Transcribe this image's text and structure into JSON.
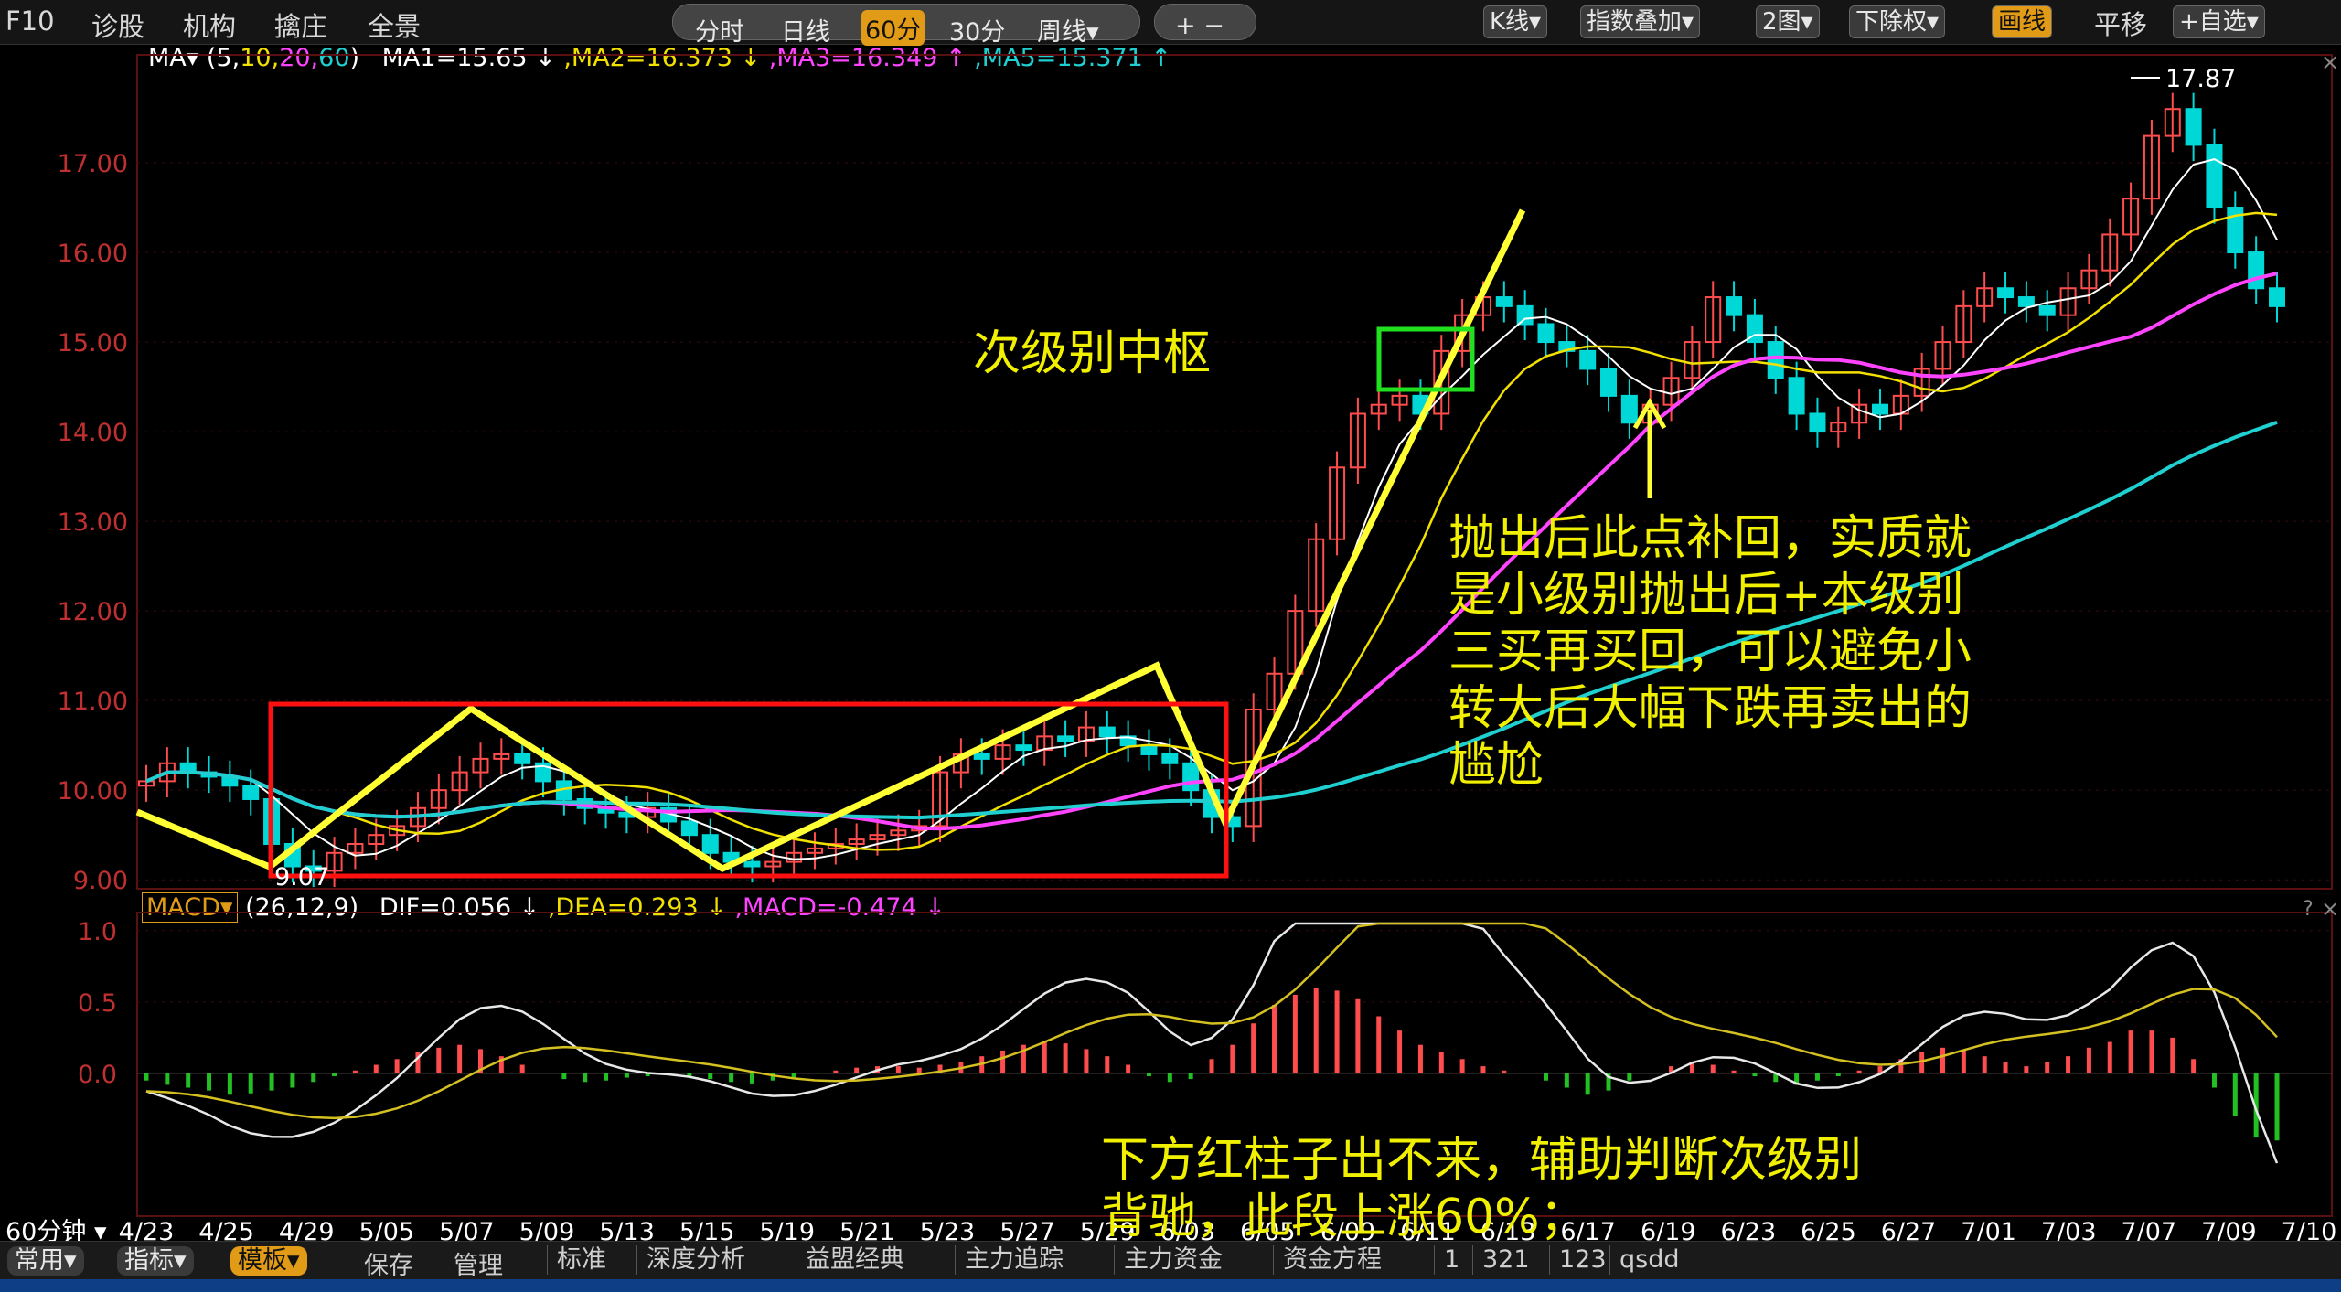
{
  "toolbar": {
    "left_items": [
      "F10",
      "诊股",
      "机构",
      "擒庄",
      "全景"
    ],
    "period_tabs": [
      "分时",
      "日线",
      "60分",
      "30分",
      "周线▾"
    ],
    "active_period": "60分",
    "zoom_controls": "+ −",
    "right_buttons": [
      "K线▾",
      "指数叠加▾",
      "2图▾",
      "下除权▾",
      "画线",
      "平移",
      "+自选▾"
    ],
    "active_right": "画线"
  },
  "ma_line": {
    "label": "MA▾",
    "params_open": "(",
    "p5": "5,",
    "p10": "10,",
    "p20": "20,",
    "p60": "60",
    "params_close": ")",
    "ma1": "MA1=15.65 ↓",
    "ma2": ",MA2=16.373 ↓",
    "ma3": ",MA3=16.349 ↑",
    "ma5": ",MA5=15.371 ↑"
  },
  "macd_line": {
    "label": "MACD▾",
    "params": "(26,12,9)",
    "dif": "DIF=0.056 ↓",
    "dea": ",DEA=0.293 ↓",
    "macd": ",MACD=-0.474 ↓"
  },
  "price_axis": [
    "17.00",
    "16.00",
    "15.00",
    "14.00",
    "13.00",
    "12.00",
    "11.00",
    "10.00",
    "9.00"
  ],
  "macd_axis": [
    "1.0",
    "0.5",
    "0.0"
  ],
  "max_label": "17.87",
  "min_label": "9.07",
  "date_axis": {
    "period_label": "60分钟",
    "dates": [
      "4/23",
      "4/25",
      "4/29",
      "5/05",
      "5/07",
      "5/09",
      "5/13",
      "5/15",
      "5/19",
      "5/21",
      "5/23",
      "5/27",
      "5/29",
      "6/03",
      "6/05",
      "6/09",
      "6/11",
      "6/13",
      "6/17",
      "6/19",
      "6/23",
      "6/25",
      "6/27",
      "7/01",
      "7/03",
      "7/07",
      "7/09",
      "7/10"
    ]
  },
  "annotations": {
    "sub_level_center": "次级别中枢",
    "note_lines": [
      "抛出后此点补回，实质就",
      "是小级别抛出后+本级别",
      "三买再买回，可以避免小",
      "转大后大幅下跌再卖出的",
      "尴尬"
    ],
    "macd_note_lines": [
      "下方红柱子出不来，辅助判断次级别",
      "背驰，此段上涨60%；"
    ]
  },
  "bottom_bar": {
    "pills": [
      "常用▾",
      "指标▾",
      "模板▾"
    ],
    "active_pill": "模板▾",
    "items": [
      "保存",
      "管理"
    ],
    "tabs": [
      "标准",
      "深度分析",
      "益盟经典",
      "主力追踪",
      "主力资金",
      "资金方程",
      "1",
      "321",
      "123",
      "qsdd"
    ]
  },
  "panel_icons": [
    "?",
    "×"
  ],
  "colors": {
    "up": "#ff4d4d",
    "down": "#00d8d8",
    "ma5": "#ffffff",
    "ma10": "#f2e000",
    "ma20": "#ff44ff",
    "ma60": "#20d0d0",
    "annotation": "#f0f000",
    "box_red": "#ff1010",
    "box_green": "#20e020",
    "active_tab": "#e29b16"
  },
  "chart_data": {
    "type": "candlestick",
    "ylim": [
      8.9,
      18.0
    ],
    "macd_ylim": [
      -1.0,
      1.05
    ],
    "highest": 17.87,
    "lowest": 9.07,
    "series": [
      {
        "name": "MA1",
        "value": 15.65
      },
      {
        "name": "MA2",
        "value": 16.373
      },
      {
        "name": "MA3",
        "value": 16.349
      },
      {
        "name": "MA5",
        "value": 15.371
      },
      {
        "name": "DIF",
        "value": 0.056
      },
      {
        "name": "DEA",
        "value": 0.293
      },
      {
        "name": "MACD",
        "value": -0.474
      }
    ],
    "closes": [
      10.1,
      10.3,
      10.2,
      10.15,
      10.05,
      9.9,
      9.4,
      9.15,
      9.1,
      9.3,
      9.4,
      9.5,
      9.6,
      9.8,
      10.0,
      10.2,
      10.35,
      10.4,
      10.3,
      10.1,
      9.9,
      9.8,
      9.75,
      9.7,
      9.8,
      9.65,
      9.5,
      9.3,
      9.2,
      9.15,
      9.2,
      9.3,
      9.35,
      9.4,
      9.45,
      9.5,
      9.55,
      9.6,
      10.2,
      10.4,
      10.35,
      10.5,
      10.45,
      10.6,
      10.55,
      10.7,
      10.6,
      10.5,
      10.4,
      10.3,
      10.0,
      9.7,
      9.6,
      10.9,
      11.3,
      12.0,
      12.8,
      13.6,
      14.2,
      14.3,
      14.4,
      14.2,
      14.9,
      15.3,
      15.5,
      15.4,
      15.2,
      15.0,
      14.9,
      14.7,
      14.4,
      14.1,
      14.3,
      14.6,
      15.0,
      15.5,
      15.3,
      15.0,
      14.6,
      14.2,
      14.0,
      14.1,
      14.3,
      14.2,
      14.4,
      14.7,
      15.0,
      15.4,
      15.6,
      15.5,
      15.4,
      15.3,
      15.6,
      15.8,
      16.2,
      16.6,
      17.3,
      17.6,
      17.2,
      16.5,
      16.0,
      15.6,
      15.4
    ],
    "macd_bars": [
      -0.05,
      -0.08,
      -0.1,
      -0.12,
      -0.15,
      -0.14,
      -0.12,
      -0.1,
      -0.06,
      -0.02,
      0.02,
      0.06,
      0.1,
      0.15,
      0.18,
      0.2,
      0.17,
      0.12,
      0.06,
      0.0,
      -0.04,
      -0.06,
      -0.05,
      -0.03,
      -0.02,
      -0.01,
      -0.02,
      -0.04,
      -0.06,
      -0.07,
      -0.05,
      -0.03,
      0.0,
      0.02,
      0.04,
      0.05,
      0.05,
      0.04,
      0.06,
      0.08,
      0.12,
      0.16,
      0.2,
      0.22,
      0.21,
      0.17,
      0.12,
      0.06,
      -0.02,
      -0.06,
      -0.04,
      0.1,
      0.2,
      0.35,
      0.48,
      0.55,
      0.6,
      0.58,
      0.52,
      0.4,
      0.3,
      0.2,
      0.15,
      0.1,
      0.05,
      0.02,
      0.0,
      -0.05,
      -0.1,
      -0.15,
      -0.12,
      -0.05,
      0.0,
      0.05,
      0.08,
      0.06,
      0.02,
      -0.02,
      -0.06,
      -0.08,
      -0.05,
      -0.02,
      0.02,
      0.05,
      0.1,
      0.15,
      0.18,
      0.16,
      0.12,
      0.08,
      0.05,
      0.08,
      0.12,
      0.18,
      0.22,
      0.3,
      0.3,
      0.25,
      0.1,
      -0.1,
      -0.3,
      -0.45,
      -0.47
    ]
  }
}
